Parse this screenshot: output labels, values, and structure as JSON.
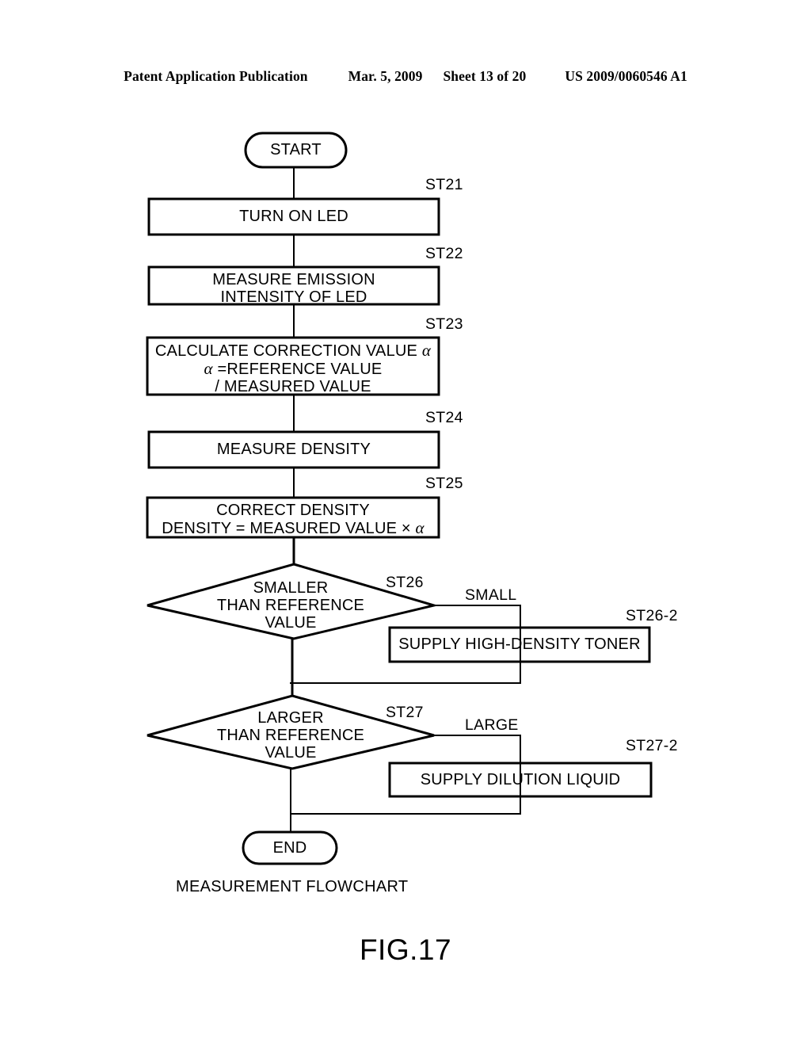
{
  "header": {
    "publication": "Patent Application Publication",
    "date": "Mar. 5, 2009",
    "sheet": "Sheet 13 of 20",
    "patent_number": "US 2009/0060546 A1"
  },
  "figure": {
    "caption": "MEASUREMENT FLOWCHART",
    "number": "FIG.17"
  },
  "chart_data": {
    "type": "diagram",
    "title": "MEASUREMENT FLOWCHART",
    "nodes": [
      {
        "id": "start",
        "tag": "",
        "shape": "terminator",
        "text": "START"
      },
      {
        "id": "st21",
        "tag": "ST21",
        "shape": "process",
        "text": "TURN ON LED"
      },
      {
        "id": "st22",
        "tag": "ST22",
        "shape": "process",
        "text": "MEASURE EMISSION\nINTENSITY OF LED"
      },
      {
        "id": "st23",
        "tag": "ST23",
        "shape": "process",
        "text": "CALCULATE CORRECTION VALUE α\nα =REFERENCE VALUE\n/ MEASURED VALUE"
      },
      {
        "id": "st24",
        "tag": "ST24",
        "shape": "process",
        "text": "MEASURE DENSITY"
      },
      {
        "id": "st25",
        "tag": "ST25",
        "shape": "process",
        "text": "CORRECT DENSITY\nDENSITY = MEASURED VALUE × α"
      },
      {
        "id": "st26",
        "tag": "ST26",
        "shape": "decision",
        "text": "SMALLER\nTHAN REFERENCE\nVALUE"
      },
      {
        "id": "st26_2",
        "tag": "ST26-2",
        "shape": "process",
        "text": "SUPPLY HIGH-DENSITY TONER"
      },
      {
        "id": "st27",
        "tag": "ST27",
        "shape": "decision",
        "text": "LARGER\nTHAN REFERENCE\nVALUE"
      },
      {
        "id": "st27_2",
        "tag": "ST27-2",
        "shape": "process",
        "text": "SUPPLY DILUTION LIQUID"
      },
      {
        "id": "end",
        "tag": "",
        "shape": "terminator",
        "text": "END"
      }
    ],
    "edges": [
      {
        "from": "start",
        "to": "st21",
        "label": ""
      },
      {
        "from": "st21",
        "to": "st22",
        "label": ""
      },
      {
        "from": "st22",
        "to": "st23",
        "label": ""
      },
      {
        "from": "st23",
        "to": "st24",
        "label": ""
      },
      {
        "from": "st24",
        "to": "st25",
        "label": ""
      },
      {
        "from": "st25",
        "to": "st26",
        "label": ""
      },
      {
        "from": "st26",
        "to": "st26_2",
        "label": "SMALL"
      },
      {
        "from": "st26",
        "to": "st27",
        "label": ""
      },
      {
        "from": "st26_2",
        "to": "st27",
        "label": ""
      },
      {
        "from": "st27",
        "to": "st27_2",
        "label": "LARGE"
      },
      {
        "from": "st27",
        "to": "end",
        "label": ""
      },
      {
        "from": "st27_2",
        "to": "end",
        "label": ""
      }
    ]
  },
  "nodes": {
    "start_text": "START",
    "st21_text": "TURN ON LED",
    "st21_tag": "ST21",
    "st22_line1": "MEASURE EMISSION",
    "st22_line2": "INTENSITY OF LED",
    "st22_tag": "ST22",
    "st23_line1_pre": "CALCULATE CORRECTION VALUE ",
    "st23_line1_alpha": "α",
    "st23_line2_alpha": "α",
    "st23_line2_post": " =REFERENCE VALUE",
    "st23_line3": "/ MEASURED VALUE",
    "st23_tag": "ST23",
    "st24_text": "MEASURE DENSITY",
    "st24_tag": "ST24",
    "st25_line1": "CORRECT DENSITY",
    "st25_line2_pre": "DENSITY = MEASURED VALUE × ",
    "st25_line2_alpha": "α",
    "st25_tag": "ST25",
    "st26_line1": "SMALLER",
    "st26_line2": "THAN REFERENCE",
    "st26_line3": "VALUE",
    "st26_tag": "ST26",
    "st26_branch": "SMALL",
    "st26_2_text": "SUPPLY HIGH-DENSITY TONER",
    "st26_2_tag": "ST26-2",
    "st27_line1": "LARGER",
    "st27_line2": "THAN REFERENCE",
    "st27_line3": "VALUE",
    "st27_tag": "ST27",
    "st27_branch": "LARGE",
    "st27_2_text": "SUPPLY DILUTION LIQUID",
    "st27_2_tag": "ST27-2",
    "end_text": "END"
  },
  "colors": {
    "ink": "#000000",
    "paper": "#ffffff"
  }
}
